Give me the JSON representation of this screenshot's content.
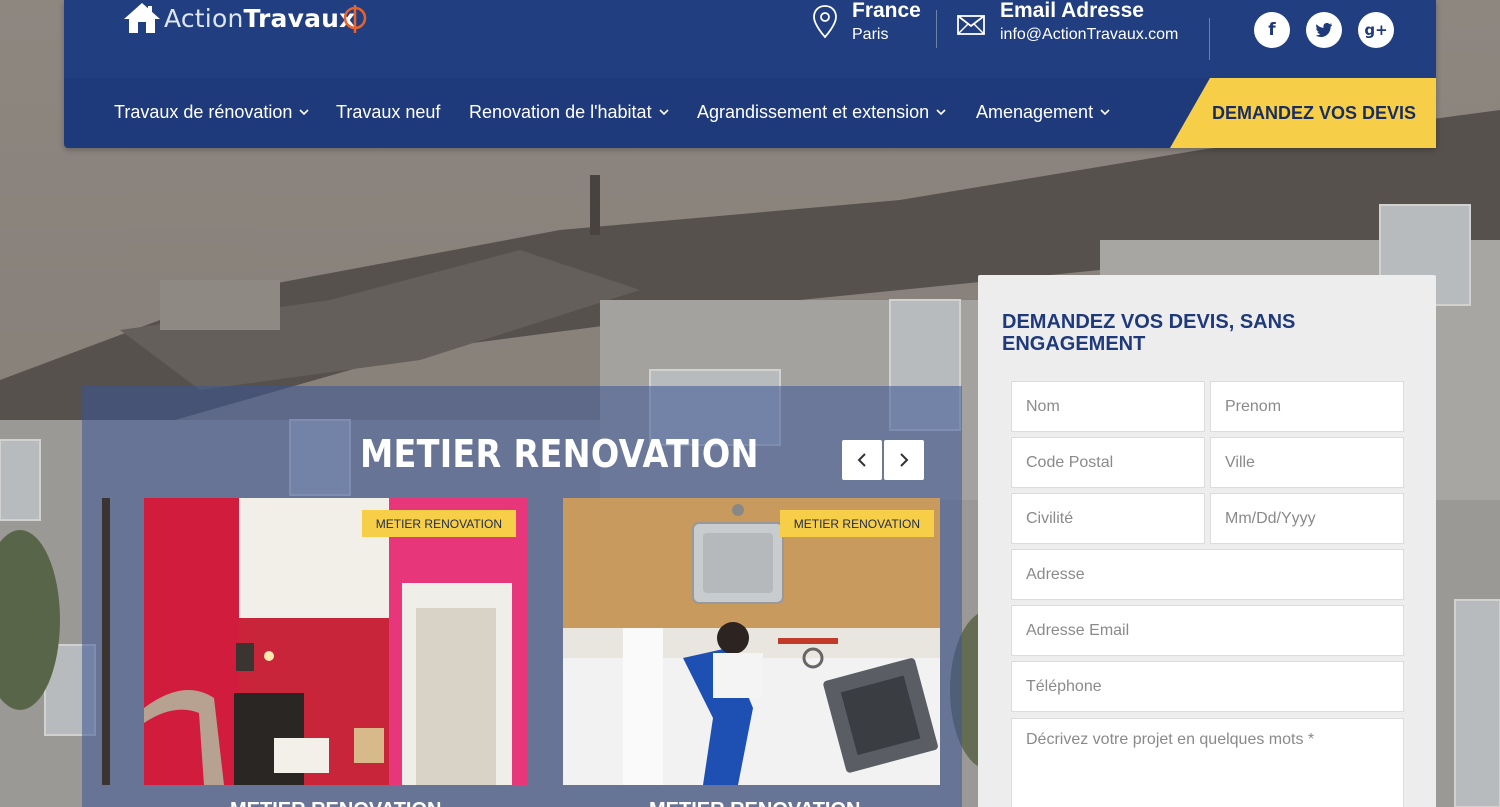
{
  "brand": {
    "logo_prefix": "Action",
    "logo_suffix": "Travaux"
  },
  "contact": {
    "location_title": "France",
    "location_sub": "Paris",
    "email_title": "Email Adresse",
    "email_sub": "info@ActionTravaux.com"
  },
  "social": {
    "facebook": "f",
    "twitter": "t",
    "google": "g+"
  },
  "nav": {
    "items": [
      {
        "label": "Travaux de rénovation",
        "has_dropdown": true
      },
      {
        "label": "Travaux neuf",
        "has_dropdown": false
      },
      {
        "label": "Renovation de l'habitat",
        "has_dropdown": true
      },
      {
        "label": "Agrandissement et extension",
        "has_dropdown": true
      },
      {
        "label": "Amenagement",
        "has_dropdown": true
      }
    ],
    "cta": "DEMANDEZ VOS DEVIS"
  },
  "metier": {
    "title": "METIER RENOVATION",
    "cards": [
      {
        "badge": "METIER RENOVATION",
        "caption": "METIER RENOVATION"
      },
      {
        "badge": "METIER RENOVATION",
        "caption": "METIER RENOVATION"
      }
    ]
  },
  "form": {
    "title": "DEMANDEZ VOS DEVIS, SANS ENGAGEMENT",
    "fields": {
      "nom": "Nom",
      "prenom": "Prenom",
      "code_postal": "Code Postal",
      "ville": "Ville",
      "civilite": "Civilité",
      "date": "Mm/Dd/Yyyy",
      "adresse": "Adresse",
      "email": "Adresse Email",
      "telephone": "Téléphone",
      "description": "Décrivez votre projet en quelques mots *"
    }
  },
  "colors": {
    "header_blue": "#1f3a7a",
    "accent_yellow": "#f7ce48",
    "form_title_blue": "#1f3a7a"
  }
}
